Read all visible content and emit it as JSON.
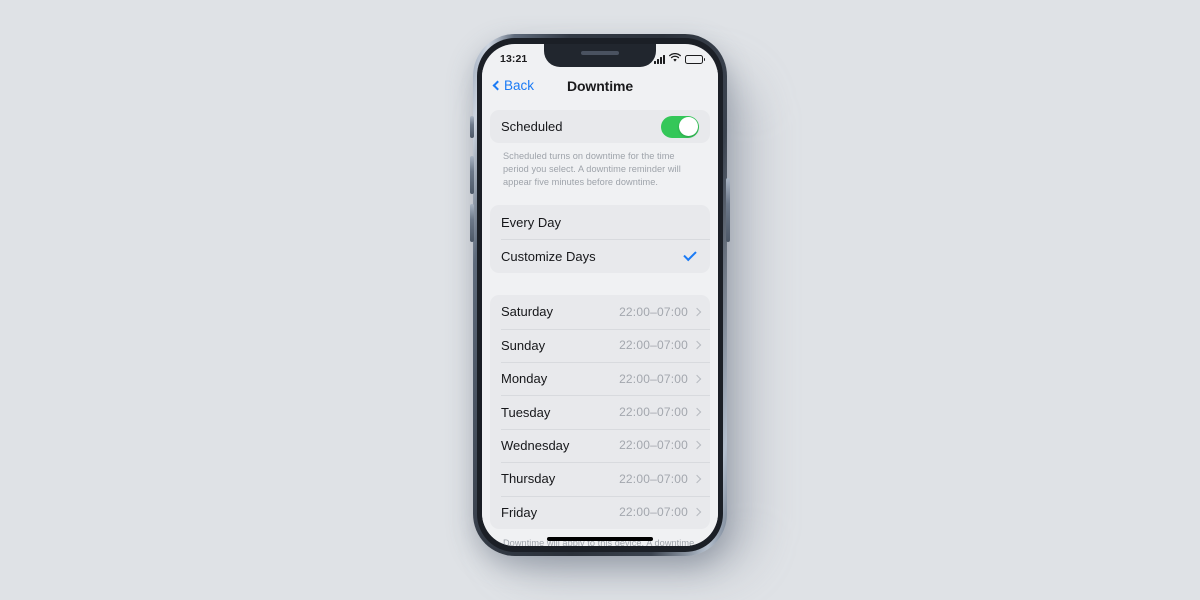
{
  "status_bar": {
    "time": "13:21",
    "signal_icon": "cellular-signal-icon",
    "wifi_icon": "wifi-icon",
    "battery_icon": "battery-icon"
  },
  "nav": {
    "back_label": "Back",
    "title": "Downtime"
  },
  "scheduled": {
    "label": "Scheduled",
    "toggle_state": "on",
    "toggle_color": "#34c759",
    "description": "Scheduled turns on downtime for the time period you select. A downtime reminder will appear five minutes before downtime."
  },
  "options": [
    {
      "label": "Every Day",
      "selected": false
    },
    {
      "label": "Customize Days",
      "selected": true
    }
  ],
  "accent_color": "#1b7bf5",
  "days": [
    {
      "name": "Saturday",
      "time": "22:00–07:00"
    },
    {
      "name": "Sunday",
      "time": "22:00–07:00"
    },
    {
      "name": "Monday",
      "time": "22:00–07:00"
    },
    {
      "name": "Tuesday",
      "time": "22:00–07:00"
    },
    {
      "name": "Wednesday",
      "time": "22:00–07:00"
    },
    {
      "name": "Thursday",
      "time": "22:00–07:00"
    },
    {
      "name": "Friday",
      "time": "22:00–07:00"
    }
  ],
  "bottom_note": "Downtime will apply to this device. A downtime reminder will appear five minutes"
}
